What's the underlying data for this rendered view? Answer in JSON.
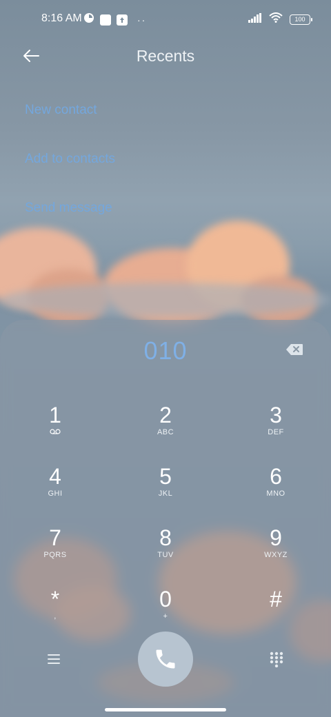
{
  "status_bar": {
    "time": "8:16 AM",
    "battery": "100",
    "icons": [
      "notification-icon",
      "square-icon",
      "upload-icon",
      "more-dots-icon",
      "signal-icon",
      "wifi-icon",
      "battery-icon"
    ],
    "dots": "··"
  },
  "header": {
    "title": "Recents",
    "back_icon": "arrow-left-icon"
  },
  "menu": {
    "items": [
      {
        "label": "New contact"
      },
      {
        "label": "Add to contacts"
      },
      {
        "label": "Send message"
      }
    ]
  },
  "dialpad": {
    "number": "010",
    "keys": [
      {
        "digit": "1",
        "letters": ""
      },
      {
        "digit": "2",
        "letters": "ABC"
      },
      {
        "digit": "3",
        "letters": "DEF"
      },
      {
        "digit": "4",
        "letters": "GHI"
      },
      {
        "digit": "5",
        "letters": "JKL"
      },
      {
        "digit": "6",
        "letters": "MNO"
      },
      {
        "digit": "7",
        "letters": "PQRS"
      },
      {
        "digit": "8",
        "letters": "TUV"
      },
      {
        "digit": "9",
        "letters": "WXYZ"
      },
      {
        "digit": "*",
        "letters": ","
      },
      {
        "digit": "0",
        "letters": "+"
      },
      {
        "digit": "#",
        "letters": ""
      }
    ]
  },
  "colors": {
    "accent": "#74a7dd",
    "number": "#7fb0e6",
    "call_button": "#b7c4d0"
  }
}
